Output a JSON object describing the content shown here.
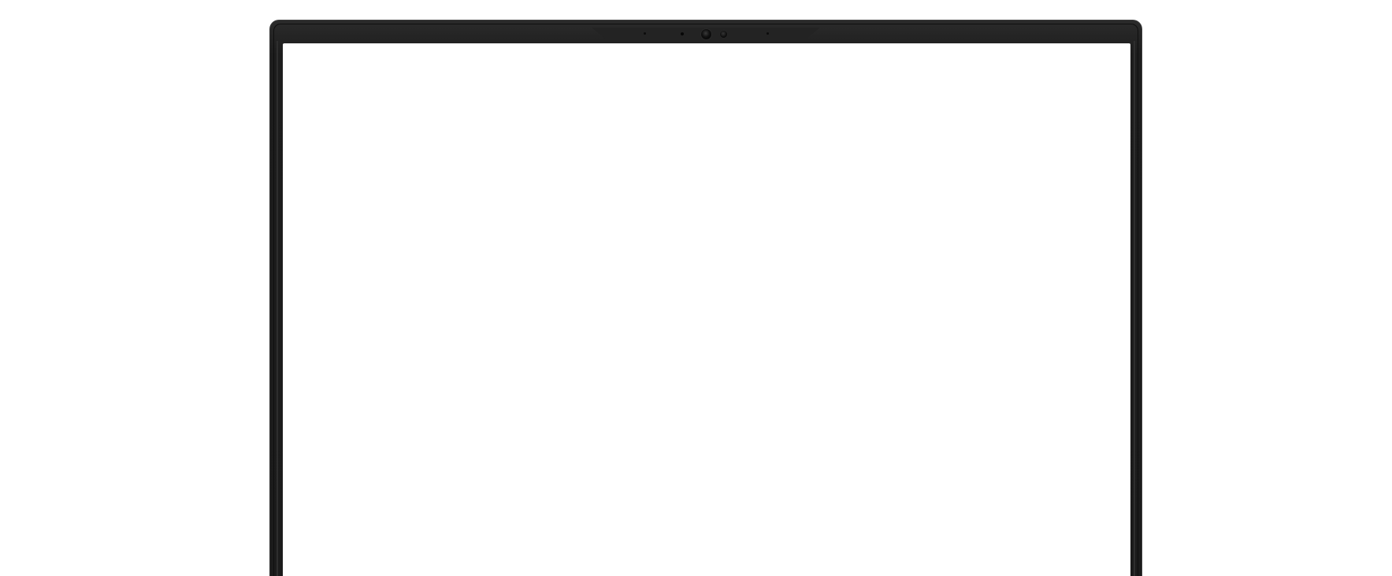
{
  "device": {
    "type": "laptop",
    "screen_state": "blank",
    "colors": {
      "background": "#ffffff",
      "bezel": "#1b1b1b",
      "screen": "#ffffff"
    },
    "icons": [
      "webcam-icon",
      "ir-sensor-icon"
    ]
  }
}
